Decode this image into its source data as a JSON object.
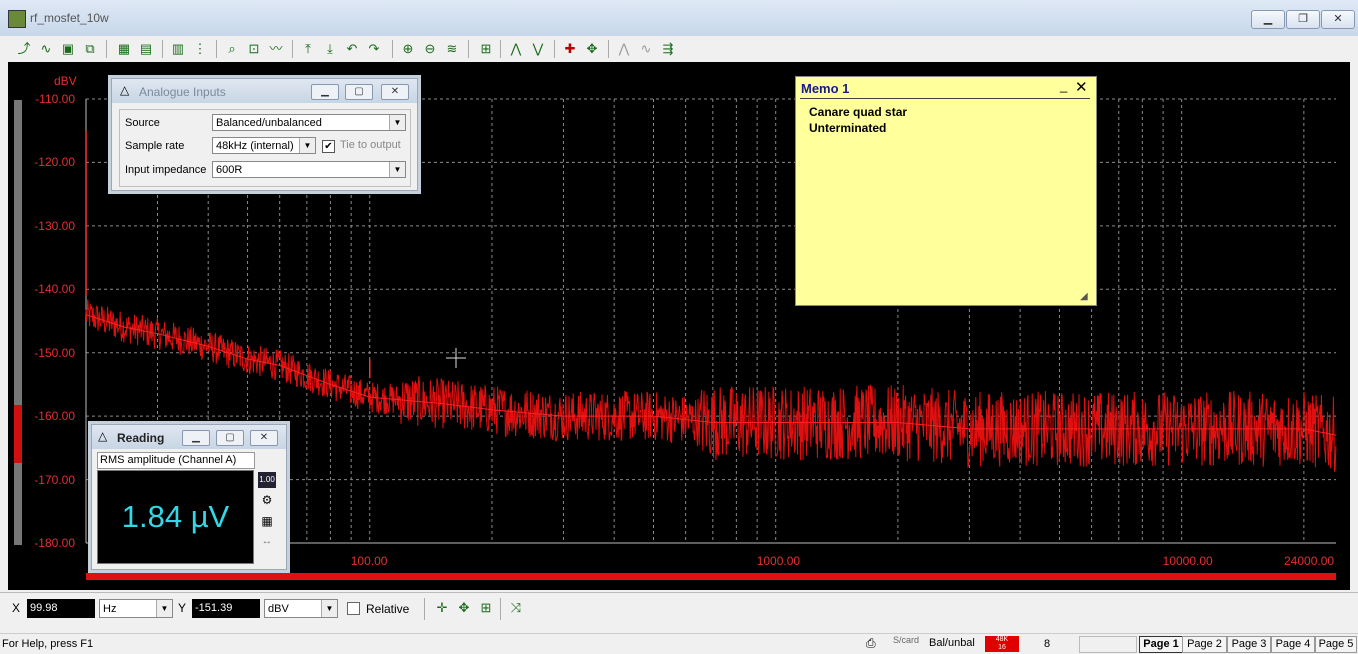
{
  "window": {
    "title": "rf_mosfet_10w"
  },
  "plot": {
    "y_unit": "dBV",
    "y_ticks": [
      "-110.00",
      "-120.00",
      "-130.00",
      "-140.00",
      "-150.00",
      "-160.00",
      "-170.00",
      "-180.00"
    ],
    "x_ticks": [
      "100.00",
      "1000.00",
      "10000.00",
      "24000.00"
    ]
  },
  "chart_data": {
    "type": "line",
    "xscale": "log",
    "xlim": [
      20,
      24000
    ],
    "ylim": [
      -180,
      -110
    ],
    "ylabel": "dBV",
    "series": [
      {
        "x": [
          20,
          25,
          30,
          40,
          50,
          60,
          80,
          100,
          150,
          200,
          300,
          500,
          700,
          1000,
          2000,
          3000,
          5000,
          10000,
          20000,
          24000
        ],
        "values": [
          -144,
          -146,
          -147,
          -149,
          -151,
          -152,
          -155,
          -157,
          -158,
          -159,
          -160,
          -160,
          -161,
          -161,
          -161,
          -162,
          -162,
          -162,
          -162,
          -163
        ]
      }
    ],
    "spikes": [
      {
        "x": 20,
        "y": -115
      },
      {
        "x": 100,
        "y": -151
      }
    ]
  },
  "analogue_inputs": {
    "title": "Analogue Inputs",
    "source_label": "Source",
    "source_value": "Balanced/unbalanced",
    "sample_rate_label": "Sample rate",
    "sample_rate_value": "48kHz (internal)",
    "tie_label": "Tie to output",
    "impedance_label": "Input impedance",
    "impedance_value": "600R"
  },
  "memo": {
    "title": "Memo 1",
    "line1": "Canare quad star",
    "line2": "Unterminated"
  },
  "reading": {
    "title": "Reading",
    "measurement": "RMS amplitude (Channel A)",
    "value": "1.84 µV",
    "side_btn_label": "1.00"
  },
  "coords": {
    "x_label": "X",
    "x_value": "99.98",
    "x_unit": "Hz",
    "y_label": "Y",
    "y_value": "-151.39",
    "y_unit": "dBV",
    "relative_label": "Relative"
  },
  "status": {
    "help": "For Help, press F1",
    "scard": "S/card",
    "mode": "Bal/unbal",
    "badge_top": "48K",
    "badge_bottom": "16",
    "count": "8",
    "pages": [
      "Page 1",
      "Page 2",
      "Page 3",
      "Page 4",
      "Page 5"
    ]
  }
}
